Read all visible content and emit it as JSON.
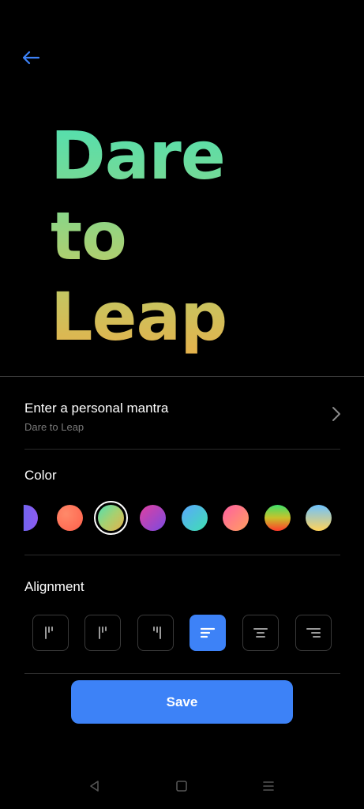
{
  "preview": {
    "lines": [
      "Dare",
      "to",
      "Leap"
    ]
  },
  "mantra": {
    "title": "Enter a personal mantra",
    "value": "Dare to Leap"
  },
  "color": {
    "label": "Color",
    "swatches": [
      {
        "name": "blue-purple",
        "from": "#5b6cf0",
        "to": "#8e5bf0"
      },
      {
        "name": "coral",
        "from": "#ff7a5c",
        "to": "#ff6b4f"
      },
      {
        "name": "green-gold",
        "from": "#4fe0b2",
        "to": "#e6b14b",
        "selected": true
      },
      {
        "name": "magenta-purple",
        "from": "#e040a0",
        "to": "#7a4be0"
      },
      {
        "name": "cyan-teal",
        "from": "#5aa7ff",
        "to": "#3fe0b0"
      },
      {
        "name": "pink-orange",
        "from": "#ff5fa0",
        "to": "#ffa060"
      },
      {
        "name": "green-red",
        "from": "#3ee06a",
        "to": "#ff3b2b"
      },
      {
        "name": "blue-yellow",
        "from": "#6ec3ff",
        "to": "#ffd25a"
      }
    ]
  },
  "alignment": {
    "label": "Alignment",
    "active_index": 3
  },
  "save_label": "Save",
  "colors": {
    "accent": "#3d82f7",
    "back_arrow": "#3d82f7"
  }
}
